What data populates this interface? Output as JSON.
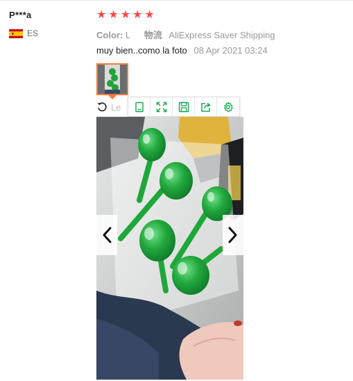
{
  "reviewer": {
    "name": "P***a",
    "country_code": "ES",
    "flag_colors": [
      "#c60b1e",
      "#ffc400"
    ]
  },
  "rating": {
    "stars": 5,
    "max": 5,
    "color": "#ff4747"
  },
  "meta": {
    "color_label": "Color:",
    "color_value": "L",
    "shipping_label": "物流",
    "shipping_value": "AliExpress Saver Shipping"
  },
  "review": {
    "text": "muy bien..como la foto",
    "date": "08 Apr 2021 03:24"
  },
  "viewer": {
    "rotate_label": "Le",
    "tools": [
      "original-size",
      "fullscreen",
      "save",
      "share",
      "settings"
    ],
    "accent_color": "#1aaa55"
  }
}
